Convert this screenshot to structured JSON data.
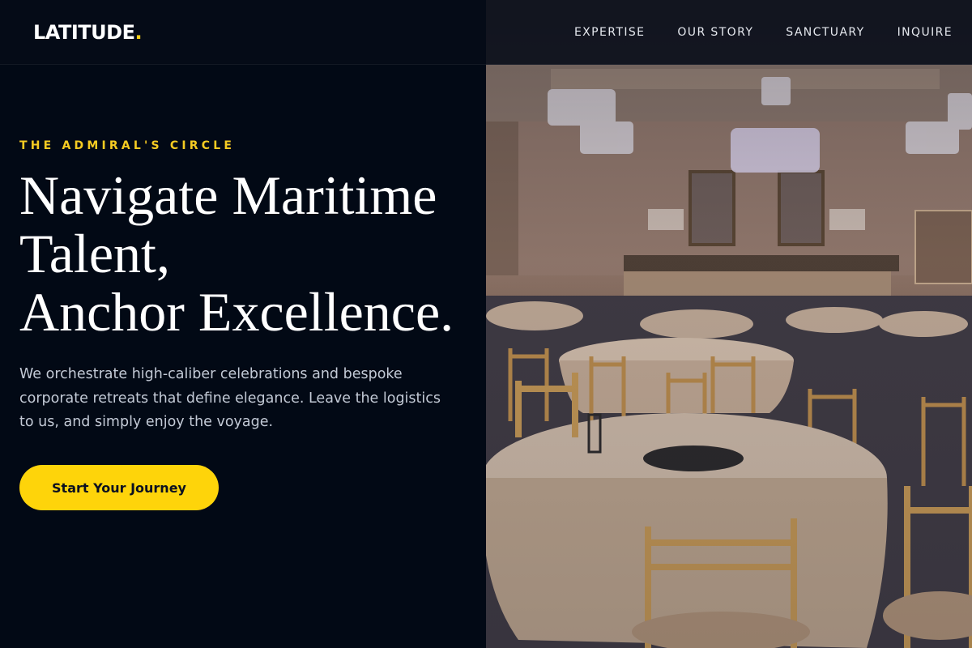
{
  "header": {
    "logo_text": "LATITUDE",
    "logo_dot": ".",
    "nav": [
      {
        "label": "EXPERTISE"
      },
      {
        "label": "OUR STORY"
      },
      {
        "label": "SANCTUARY"
      },
      {
        "label": "INQUIRE"
      }
    ]
  },
  "hero": {
    "eyebrow": "THE ADMIRAL'S CIRCLE",
    "headline_lines": [
      "Navigate Maritime",
      "Talent,",
      "Anchor Excellence."
    ],
    "description": "We orchestrate high-caliber celebrations and bespoke corporate retreats that define elegance. Leave the logistics to us, and simply enjoy the voyage.",
    "cta_label": "Start Your Journey"
  },
  "colors": {
    "accent": "#fed40a",
    "background": "#020915",
    "text": "#ffffff",
    "muted_text": "#c3cad6"
  }
}
